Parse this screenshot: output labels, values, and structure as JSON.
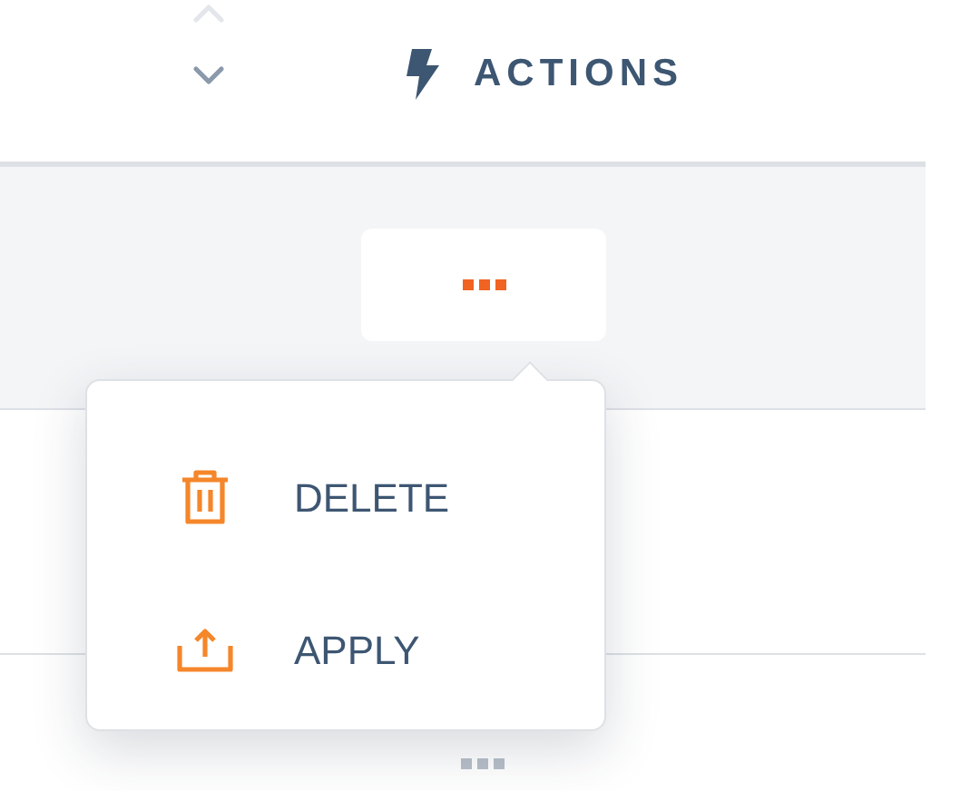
{
  "header": {
    "label": "ACTIONS",
    "sort_descending": true
  },
  "menu": {
    "items": [
      {
        "kind": "delete",
        "label": "DELETE"
      },
      {
        "kind": "apply",
        "label": "APPLY"
      }
    ]
  }
}
